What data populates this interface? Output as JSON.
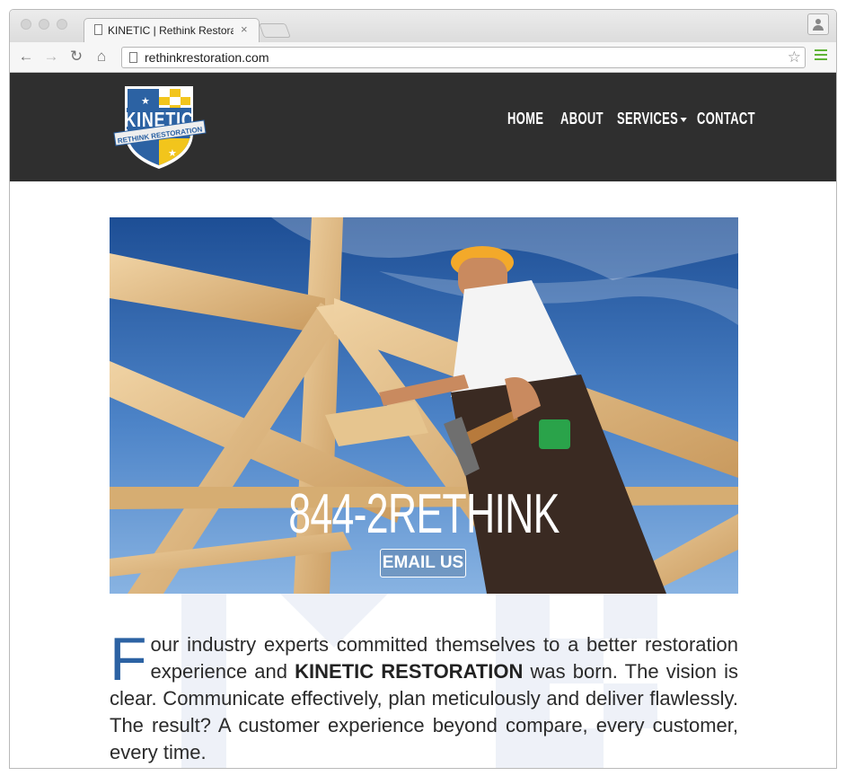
{
  "browser": {
    "tab_title": "KINETIC | Rethink Restorati",
    "tab_close": "×",
    "url": "rethinkrestoration.com",
    "icons": {
      "back": "←",
      "forward": "→",
      "reload": "↻",
      "home": "⌂",
      "bookmark": "☆"
    }
  },
  "header": {
    "logo_text": "KINETIC",
    "logo_ribbon": "RETHINK RESTORATION",
    "nav": {
      "home": "HOME",
      "about": "ABOUT",
      "services": "SERVICES",
      "contact": "CONTACT"
    }
  },
  "hero": {
    "phone": "844-2RETHINK",
    "email_button": "EMAIL US"
  },
  "intro": {
    "dropcap": "F",
    "text_part1": "our industry experts committed themselves to a better restoration experience and",
    "brand": "KINETIC RESTORATION",
    "text_part2": "was born. The vision is clear. Communicate effectively, plan meticulously and deliver flawlessly. The result? A customer experience beyond compare, every customer, every time."
  },
  "colors": {
    "header_bg": "#2f2f2f",
    "accent_blue": "#2c62a3",
    "chrome_menu_green": "#5fb336"
  }
}
